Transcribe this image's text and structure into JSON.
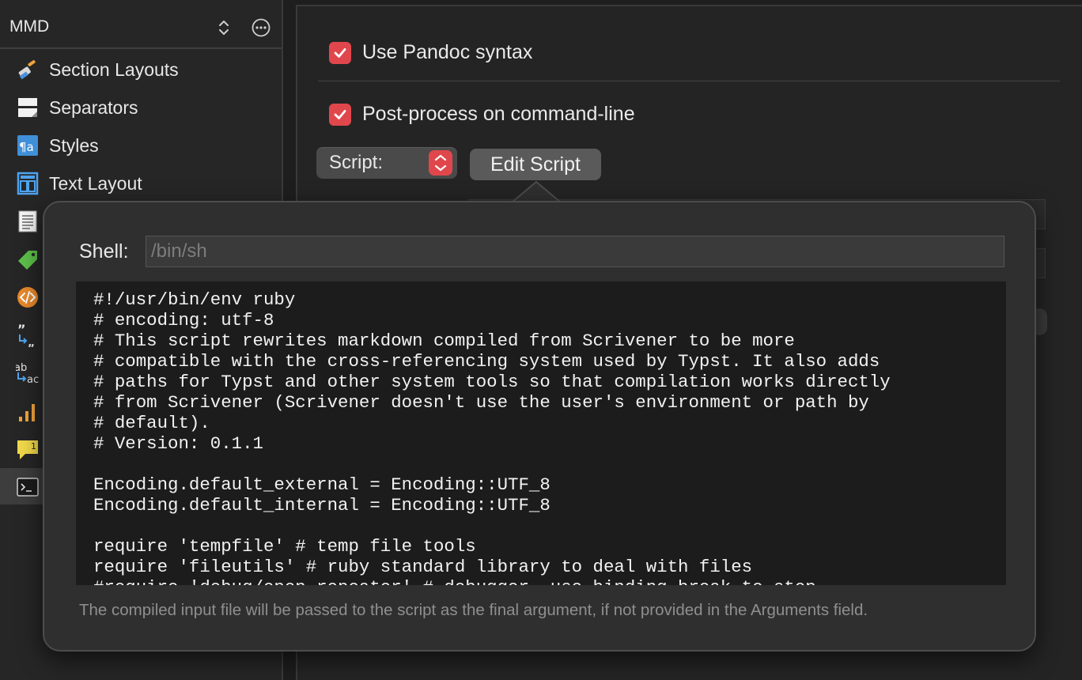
{
  "sidebar": {
    "title": "MMD",
    "items": [
      {
        "label": "Section Layouts",
        "icon": "brush-icon"
      },
      {
        "label": "Separators",
        "icon": "separator-icon"
      },
      {
        "label": "Styles",
        "icon": "styles-icon"
      },
      {
        "label": "Text Layout",
        "icon": "text-layout-icon"
      },
      {
        "label": "",
        "icon": "document-icon"
      },
      {
        "label": "",
        "icon": "tag-icon"
      },
      {
        "label": "",
        "icon": "code-icon"
      },
      {
        "label": "",
        "icon": "quote-replace-icon"
      },
      {
        "label": "",
        "icon": "text-replace-icon"
      },
      {
        "label": "",
        "icon": "chart-icon"
      },
      {
        "label": "",
        "icon": "comment-icon",
        "badge": "1"
      },
      {
        "label": "",
        "icon": "terminal-icon",
        "selected": true
      }
    ]
  },
  "main": {
    "use_pandoc_label": "Use Pandoc syntax",
    "use_pandoc_checked": true,
    "post_process_label": "Post-process on command-line",
    "post_process_checked": true,
    "script_popup_label": "Script:",
    "edit_script_label": "Edit Script"
  },
  "popover": {
    "shell_label": "Shell:",
    "shell_placeholder": "/bin/sh",
    "script_text": "#!/usr/bin/env ruby\n# encoding: utf-8\n# This script rewrites markdown compiled from Scrivener to be more\n# compatible with the cross-referencing system used by Typst. It also adds\n# paths for Typst and other system tools so that compilation works directly\n# from Scrivener (Scrivener doesn't use the user's environment or path by\n# default).\n# Version: 0.1.1\n\nEncoding.default_external = Encoding::UTF_8\nEncoding.default_internal = Encoding::UTF_8\n\nrequire 'tempfile' # temp file tools\nrequire 'fileutils' # ruby standard library to deal with files\n#require 'debug/open_repeater' # debugger, use binding.break to stop",
    "hint": "The compiled input file will be passed to the script as the final argument, if not provided in the Arguments field."
  },
  "colors": {
    "accent": "#e0474c",
    "background": "#1e1e1e",
    "editor_bg": "#1c1c1c"
  }
}
